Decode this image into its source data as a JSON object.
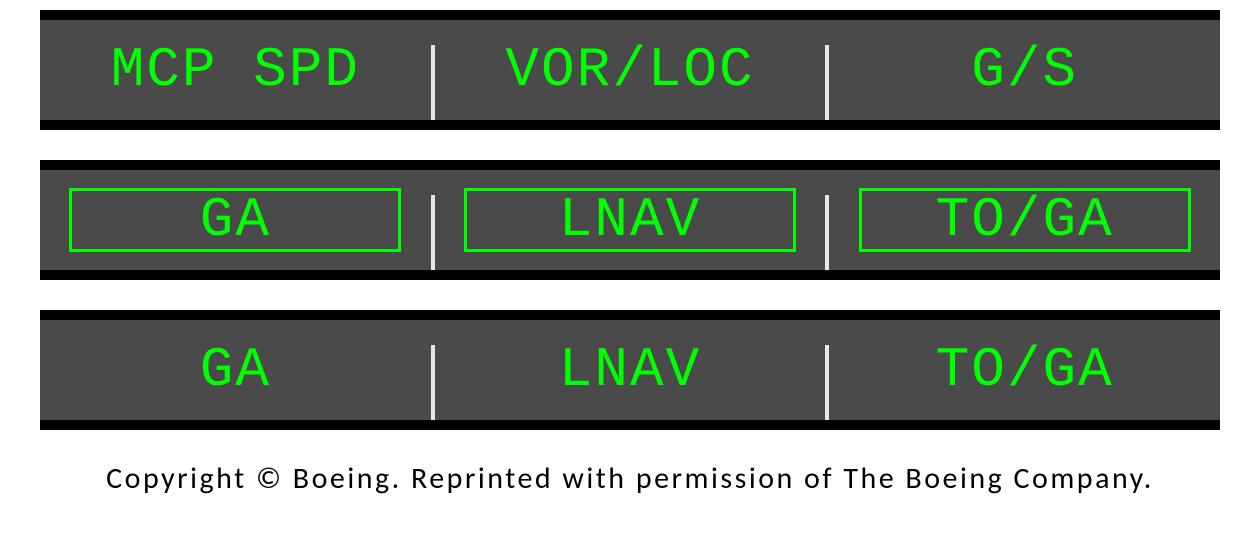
{
  "panels": [
    {
      "boxed": false,
      "modes": {
        "thrust": "MCP SPD",
        "roll": "VOR/LOC",
        "pitch": "G/S"
      }
    },
    {
      "boxed": true,
      "modes": {
        "thrust": "GA",
        "roll": "LNAV",
        "pitch": "TO/GA"
      }
    },
    {
      "boxed": false,
      "modes": {
        "thrust": "GA",
        "roll": "LNAV",
        "pitch": "TO/GA"
      }
    }
  ],
  "copyright": "Copyright © Boeing. Reprinted with permission of The Boeing Company.",
  "colors": {
    "text": "#00ff00",
    "background_strip": "#4a4a4a",
    "background_panel": "#000000"
  }
}
